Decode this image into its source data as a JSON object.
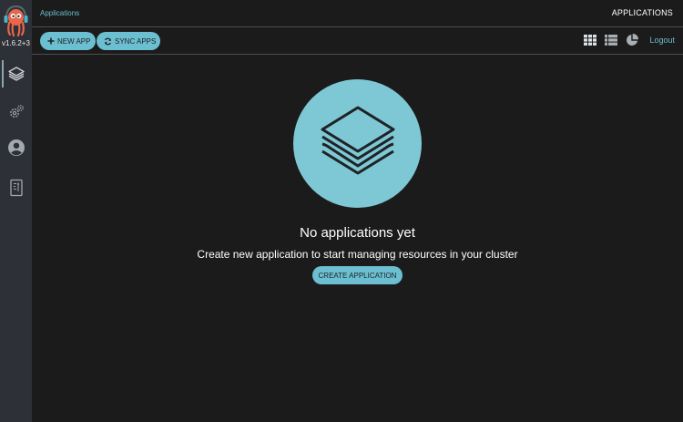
{
  "sidebar": {
    "version": "v1.6.2+3",
    "items": [
      {
        "icon": "applications-icon",
        "active": true
      },
      {
        "icon": "settings-icon",
        "active": false
      },
      {
        "icon": "user-info-icon",
        "active": false
      },
      {
        "icon": "documentation-icon",
        "active": false
      }
    ]
  },
  "header": {
    "breadcrumb": "Applications",
    "title": "APPLICATIONS"
  },
  "toolbar": {
    "new_app_label": "NEW APP",
    "sync_apps_label": "SYNC APPS",
    "logout_label": "Logout",
    "view_icons": [
      "tiles-view-icon",
      "list-view-icon",
      "summary-view-icon"
    ]
  },
  "empty_state": {
    "title": "No applications yet",
    "subtitle": "Create new application to start managing resources in your cluster",
    "button_label": "CREATE APPLICATION"
  },
  "colors": {
    "accent": "#6bbfd0",
    "sidebar_bg": "#2d3036",
    "page_bg": "#1b1b1b"
  }
}
